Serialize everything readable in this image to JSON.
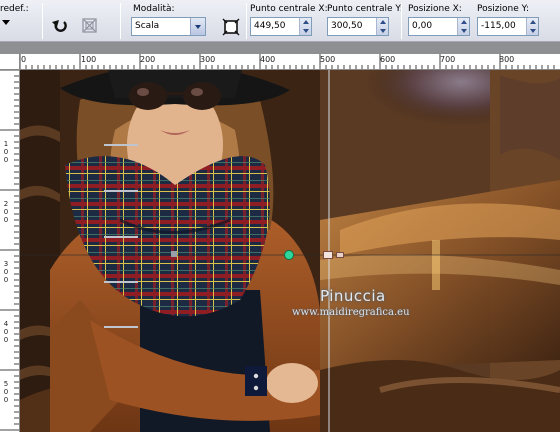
{
  "toolbar": {
    "preset_label": "redef.:",
    "mode_label": "Modalità:",
    "mode_value": "Scala",
    "center_x_label": "Punto centrale X:",
    "center_x_value": "449,50",
    "center_y_label": "Punto centrale Y:",
    "center_y_value": "300,50",
    "pos_x_label": "Posizione X:",
    "pos_x_value": "0,00",
    "pos_y_label": "Posizione Y:",
    "pos_y_value": "-115,00"
  },
  "ruler": {
    "top_labels": [
      "0",
      "100",
      "200",
      "300",
      "400",
      "500",
      "600",
      "700",
      "800"
    ],
    "left_labels": [
      "1\n0\n0",
      "2\n0\n0",
      "3\n0\n0",
      "4\n0\n0",
      "5\n0\n0"
    ]
  },
  "canvas": {
    "watermark_name": "Pinuccia",
    "watermark_url": "www.maidiregrafica.eu"
  },
  "colors": {
    "toolbar_bg": "#dde0ea",
    "field_border": "#7f9db9",
    "canvas_brown": "#5a361c",
    "guide_line": "#d8dde6",
    "handle_green": "#2fd59a"
  },
  "icons": [
    "chevron-down-icon",
    "reset-arrow-icon",
    "remove-deformation-icon",
    "fit-center-icon"
  ]
}
